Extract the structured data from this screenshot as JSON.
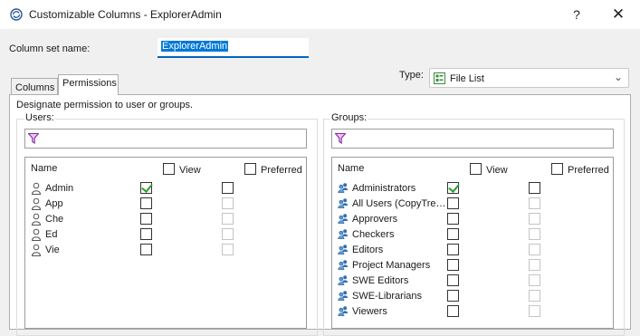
{
  "window": {
    "title": "Customizable Columns - ExplorerAdmin",
    "help_label": "?",
    "close_label": "✕"
  },
  "column_set": {
    "label": "Column set name:",
    "value": "ExplorerAdmin"
  },
  "type": {
    "label": "Type:",
    "value": "File List"
  },
  "tabs": [
    {
      "label": "Columns"
    },
    {
      "label": "Permissions"
    }
  ],
  "permissions": {
    "designate_text": "Designate permission to user or groups.",
    "headers": {
      "name": "Name",
      "view": "View",
      "preferred": "Preferred"
    }
  },
  "users": {
    "caption": "Users:",
    "filter_value": "",
    "items": [
      {
        "name": "Admin",
        "view": true,
        "preferred": false,
        "preferred_enabled": true
      },
      {
        "name": "App",
        "view": false,
        "preferred": false,
        "preferred_enabled": false
      },
      {
        "name": "Che",
        "view": false,
        "preferred": false,
        "preferred_enabled": false
      },
      {
        "name": "Ed",
        "view": false,
        "preferred": false,
        "preferred_enabled": false
      },
      {
        "name": "Vie",
        "view": false,
        "preferred": false,
        "preferred_enabled": false
      }
    ]
  },
  "groups": {
    "caption": "Groups:",
    "filter_value": "",
    "items": [
      {
        "name": "Administrators",
        "view": true,
        "preferred": false,
        "preferred_enabled": true
      },
      {
        "name": "All Users (CopyTre…",
        "view": false,
        "preferred": false,
        "preferred_enabled": false
      },
      {
        "name": "Approvers",
        "view": false,
        "preferred": false,
        "preferred_enabled": false
      },
      {
        "name": "Checkers",
        "view": false,
        "preferred": false,
        "preferred_enabled": false
      },
      {
        "name": "Editors",
        "view": false,
        "preferred": false,
        "preferred_enabled": false
      },
      {
        "name": "Project Managers",
        "view": false,
        "preferred": false,
        "preferred_enabled": false
      },
      {
        "name": "SWE Editors",
        "view": false,
        "preferred": false,
        "preferred_enabled": false
      },
      {
        "name": "SWE-Librarians",
        "view": false,
        "preferred": false,
        "preferred_enabled": false
      },
      {
        "name": "Viewers",
        "view": false,
        "preferred": false,
        "preferred_enabled": false
      }
    ]
  }
}
